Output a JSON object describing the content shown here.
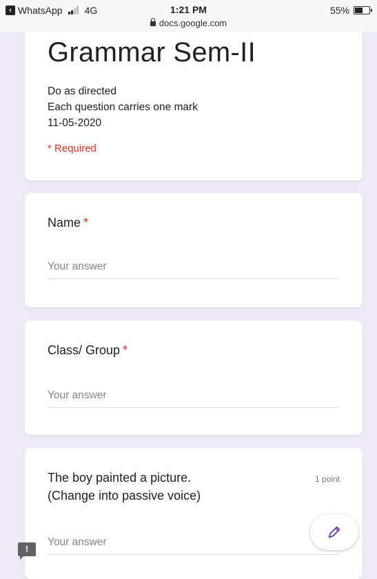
{
  "statusbar": {
    "app_back_label": "WhatsApp",
    "network": "4G",
    "time": "1:21 PM",
    "url": "docs.google.com",
    "battery": "55%",
    "battery_level": 0.55
  },
  "form": {
    "title": "Grammar Sem-II",
    "description": [
      "Do as directed",
      "Each question carries one mark",
      "11-05-2020"
    ],
    "required_note": "* Required"
  },
  "questions": [
    {
      "title": "Name",
      "required_marker": "*",
      "placeholder": "Your answer"
    },
    {
      "title": "Class/ Group",
      "required_marker": "*",
      "placeholder": "Your answer"
    },
    {
      "title_line1": "The boy painted a picture.",
      "title_line2": "(Change into passive voice)",
      "points": "1 point",
      "placeholder": "Your answer"
    }
  ],
  "colors": {
    "accent": "#673ab7",
    "required": "#d93025",
    "background": "#efe9f6"
  },
  "icons": {
    "fab": "pencil-icon",
    "report": "report-problem-icon"
  }
}
